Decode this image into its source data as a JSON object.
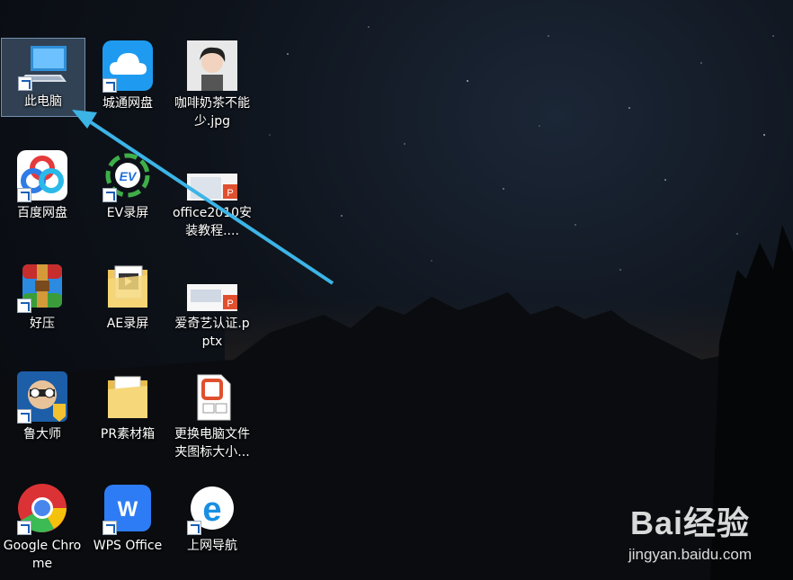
{
  "desktop": {
    "icons": [
      {
        "label": "此电脑",
        "icon": "computer-icon",
        "shortcut": true
      },
      {
        "label": "城通网盘",
        "icon": "cloud-drive-icon",
        "shortcut": true
      },
      {
        "label": "咖啡奶茶不能少.jpg",
        "icon": "image-file-icon",
        "shortcut": false
      },
      {
        "label": "百度网盘",
        "icon": "baidu-netdisk-icon",
        "shortcut": true
      },
      {
        "label": "EV录屏",
        "icon": "ev-recorder-icon",
        "shortcut": true
      },
      {
        "label": "office2010安装教程....",
        "icon": "pptx-thumbnail-icon",
        "shortcut": false
      },
      {
        "label": "好压",
        "icon": "haozip-icon",
        "shortcut": true
      },
      {
        "label": "AE录屏",
        "icon": "folder-icon",
        "shortcut": false
      },
      {
        "label": "爱奇艺认证.pptx",
        "icon": "pptx-thumbnail-icon",
        "shortcut": false
      },
      {
        "label": "鲁大师",
        "icon": "ludashi-icon",
        "shortcut": true
      },
      {
        "label": "PR素材箱",
        "icon": "folder-icon",
        "shortcut": false
      },
      {
        "label": "更换电脑文件夹图标大小...",
        "icon": "pptx-file-icon",
        "shortcut": false
      },
      {
        "label": "Google Chrome",
        "icon": "chrome-icon",
        "shortcut": true
      },
      {
        "label": "WPS Office",
        "icon": "wps-icon",
        "shortcut": true
      },
      {
        "label": "上网导航",
        "icon": "ie-icon",
        "shortcut": true
      }
    ],
    "selected_label": "此电脑"
  },
  "watermark": {
    "brand": "Bai经验",
    "url": "jingyan.baidu.com"
  },
  "colors": {
    "arrow": "#3cb4e6",
    "selection": "#5d8bb5"
  }
}
